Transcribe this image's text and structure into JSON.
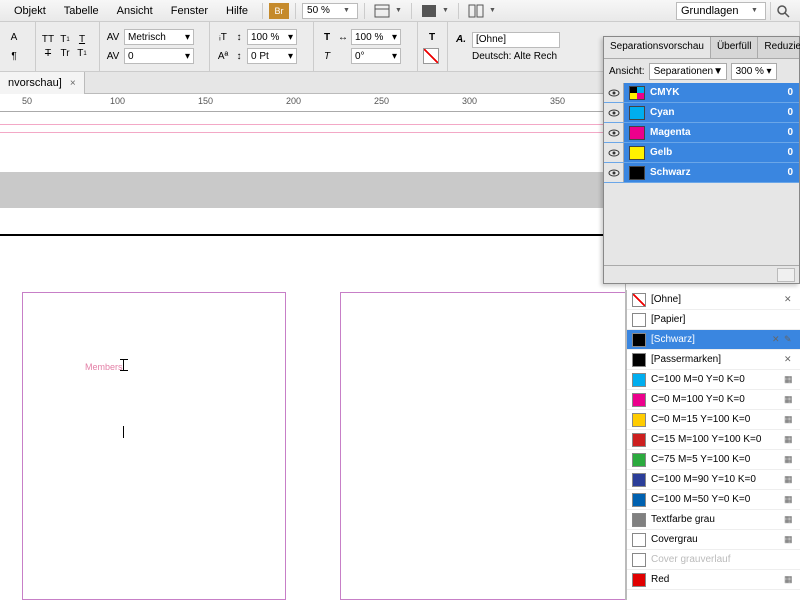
{
  "menu": {
    "objekt": "Objekt",
    "tabelle": "Tabelle",
    "ansicht": "Ansicht",
    "fenster": "Fenster",
    "hilfe": "Hilfe",
    "br": "Br",
    "zoom": "50 %",
    "layout": "Grundlagen"
  },
  "toolbar": {
    "metric": "Metrisch",
    "scale1": "100 %",
    "scale2": "100 %",
    "pt0": "0 Pt",
    "deg0": "0°",
    "ohne": "[Ohne]",
    "lang": "Deutsch: Alte Rech"
  },
  "tab": {
    "title": "nvorschau]"
  },
  "ruler": {
    "t50": "50",
    "t100": "100",
    "t150": "150",
    "t200": "200",
    "t250": "250",
    "t300": "300",
    "t350": "350"
  },
  "canvas": {
    "members": "Members"
  },
  "sep": {
    "tab1": "Separationsvorschau",
    "tab2": "Überfüll",
    "tab3": "Reduzie",
    "ansicht_lbl": "Ansicht:",
    "ansicht_val": "Separationen",
    "pct": "300 %",
    "channels": [
      {
        "name": "CMYK",
        "color": "mixed",
        "val": "0"
      },
      {
        "name": "Cyan",
        "color": "#00AEEF",
        "val": "0"
      },
      {
        "name": "Magenta",
        "color": "#EC008C",
        "val": "0"
      },
      {
        "name": "Gelb",
        "color": "#FFF200",
        "val": "0"
      },
      {
        "name": "Schwarz",
        "color": "#000000",
        "val": "0"
      }
    ]
  },
  "swatches": [
    {
      "name": "[Ohne]",
      "color": "none",
      "flags": "x"
    },
    {
      "name": "[Papier]",
      "color": "#ffffff",
      "flags": ""
    },
    {
      "name": "[Schwarz]",
      "color": "#000000",
      "flags": "px",
      "selected": true
    },
    {
      "name": "[Passermarken]",
      "color": "#000000",
      "flags": "x"
    },
    {
      "name": "C=100 M=0 Y=0 K=0",
      "color": "#00AEEF",
      "flags": "sq"
    },
    {
      "name": "C=0 M=100 Y=0 K=0",
      "color": "#EC008C",
      "flags": "sq"
    },
    {
      "name": "C=0 M=15 Y=100 K=0",
      "color": "#FFCC00",
      "flags": "sq"
    },
    {
      "name": "C=15 M=100 Y=100 K=0",
      "color": "#CC1F1F",
      "flags": "sq"
    },
    {
      "name": "C=75 M=5 Y=100 K=0",
      "color": "#2BAA3E",
      "flags": "sq"
    },
    {
      "name": "C=100 M=90 Y=10 K=0",
      "color": "#2B3E99",
      "flags": "sq"
    },
    {
      "name": "C=100 M=50 Y=0 K=0",
      "color": "#0061B0",
      "flags": "sq"
    },
    {
      "name": "Textfarbe grau",
      "color": "#808080",
      "flags": "sq"
    },
    {
      "name": "Covergrau",
      "color": "#ffffff",
      "flags": "sq"
    },
    {
      "name": "Cover grauverlauf",
      "color": "#ffffff",
      "flags": "",
      "disabled": true
    },
    {
      "name": "Red",
      "color": "#e00000",
      "flags": "sq"
    }
  ]
}
